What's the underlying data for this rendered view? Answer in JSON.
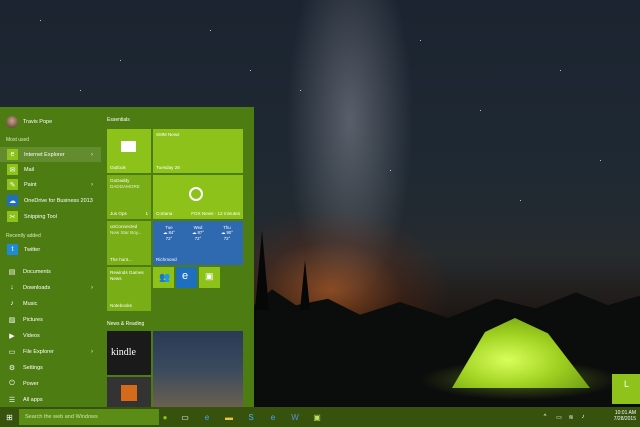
{
  "start_menu": {
    "user_name": "Travis Pope",
    "most_used_label": "Most used",
    "most_used": [
      {
        "label": "Internet Explorer",
        "icon": "internet-explorer-icon",
        "chevron": "›"
      },
      {
        "label": "Mail",
        "icon": "mail-icon",
        "chevron": ""
      },
      {
        "label": "Paint",
        "icon": "paint-icon",
        "chevron": "›"
      },
      {
        "label": "OneDrive for Business 2013",
        "icon": "onedrive-icon",
        "chevron": ""
      },
      {
        "label": "Snipping Tool",
        "icon": "scissors-icon",
        "chevron": ""
      }
    ],
    "recently_added_label": "Recently added",
    "recently_added": [
      {
        "label": "Twitter",
        "icon": "twitter-icon"
      }
    ],
    "places": [
      {
        "label": "Documents",
        "icon": "documents-icon",
        "chevron": ""
      },
      {
        "label": "Downloads",
        "icon": "downloads-icon",
        "chevron": "›"
      },
      {
        "label": "Music",
        "icon": "music-icon",
        "chevron": ""
      },
      {
        "label": "Pictures",
        "icon": "pictures-icon",
        "chevron": ""
      },
      {
        "label": "Videos",
        "icon": "videos-icon",
        "chevron": ""
      },
      {
        "label": "File Explorer",
        "icon": "file-explorer-icon",
        "chevron": "›"
      },
      {
        "label": "Settings",
        "icon": "settings-icon",
        "chevron": ""
      },
      {
        "label": "Power",
        "icon": "power-icon",
        "chevron": ""
      },
      {
        "label": "All apps",
        "icon": "all-apps-icon",
        "chevron": ""
      }
    ]
  },
  "tiles": {
    "essentials_label": "Essentials",
    "news_label": "News & Reading",
    "outlook": "Outlook",
    "calendar_top": "SMM News",
    "calendar_date": "Tuesday 28",
    "goldaddy_top": "GoDaddy",
    "goldaddy_body": "DADDAMORE",
    "goldaddy_count": "1",
    "cortana": "Cortana",
    "news_tile": "FOX News · 12 minutes",
    "jus_ops": "Jus Ops",
    "unconnected_top": "unConnected",
    "unconnected_body": "New Star Boy...",
    "weather_location": "Richmond",
    "weather": [
      {
        "day": "Tue",
        "temp": "84°",
        "low": "72°"
      },
      {
        "day": "Wed",
        "temp": "87°",
        "low": "72°"
      },
      {
        "day": "Thu",
        "temp": "90°",
        "low": "72°"
      }
    ],
    "the_hunt": "The hunt...",
    "games_top": "Rewinds Games News",
    "notebooks": "Notebooks",
    "kindle": "kindle",
    "colors": {
      "tile_light": "#8cc21a",
      "tile_mid": "#7aae17",
      "weather": "#2f6ab0",
      "start_bg": "#4d7d12"
    }
  },
  "taskbar": {
    "search_placeholder": "Search the web and Windows",
    "start_icon": "windows-logo-icon",
    "time": "10:01 AM",
    "date": "7/28/2015"
  },
  "corner_tile_text": "L"
}
